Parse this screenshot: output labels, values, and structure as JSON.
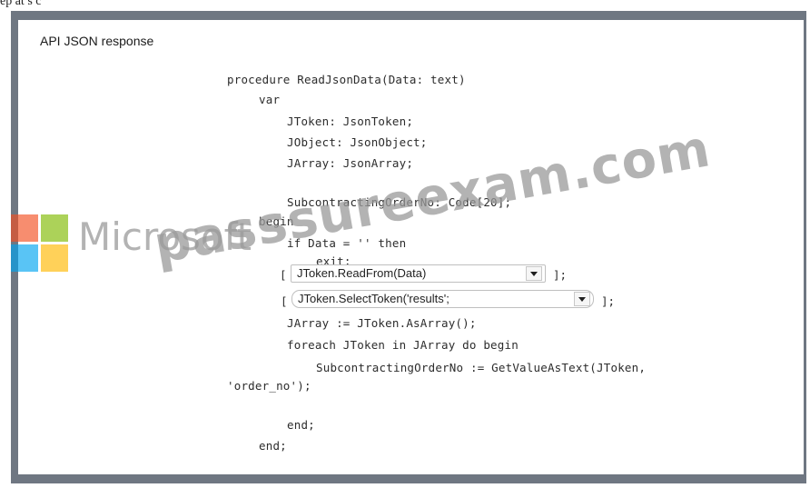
{
  "page_fragment": "ep  at s  c",
  "panel": {
    "title": "API JSON response"
  },
  "code": {
    "line1": "procedure ReadJsonData(Data: text)",
    "line2": "var",
    "line3": "JToken: JsonToken;",
    "line4": "JObject: JsonObject;",
    "line5": "JArray: JsonArray;",
    "line6": "SubcontractingOrderNo: Code[20];",
    "line7": "begin",
    "line8": "if Data = '' then",
    "line9": "exit;",
    "line12": "JArray := JToken.AsArray();",
    "line13": "foreach JToken in JArray do begin",
    "line14": "SubcontractingOrderNo := GetValueAsText(JToken,",
    "line15": "'order_no');",
    "line16": "end;",
    "line17": "end;"
  },
  "dropdowns": {
    "first": {
      "value": "JToken.ReadFrom(Data)",
      "open_bracket": "[",
      "close_bracket": "];"
    },
    "second": {
      "value": "JToken.SelectToken('results';",
      "open_bracket": "[",
      "close_bracket": "];"
    }
  },
  "watermark": {
    "brand": "Microsoft",
    "site": "passsureexam.com",
    "colors": {
      "red": "#f25022",
      "green": "#7fba00",
      "blue": "#00a4ef",
      "yellow": "#ffb900"
    }
  }
}
